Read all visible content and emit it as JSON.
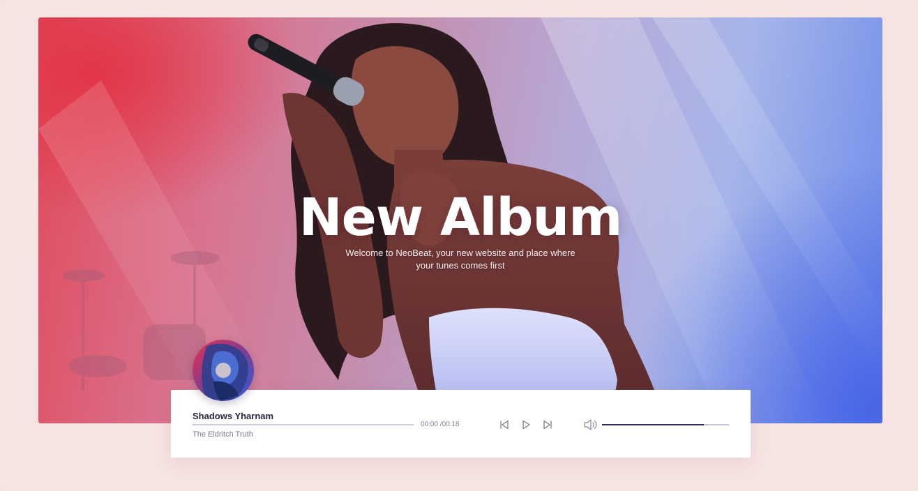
{
  "hero": {
    "title": "New Album",
    "subtitle_line1": "Welcome to NeoBeat, your new website and place where",
    "subtitle_line2": "your tunes comes first"
  },
  "player": {
    "track_title": "Shadows Yharnam",
    "track_artist": "The Eldritch Truth",
    "time_display": "00:00 /00:18",
    "progress": 0,
    "volume": 0.8,
    "controls": {
      "previous_icon": "skip-back-icon",
      "play_icon": "play-icon",
      "next_icon": "skip-forward-icon",
      "volume_icon": "volume-icon"
    }
  },
  "colors": {
    "page_background": "#f6e4e2",
    "accent": "#3a2d5c",
    "track_title": "#2b2340",
    "muted_text": "#7d778a"
  }
}
